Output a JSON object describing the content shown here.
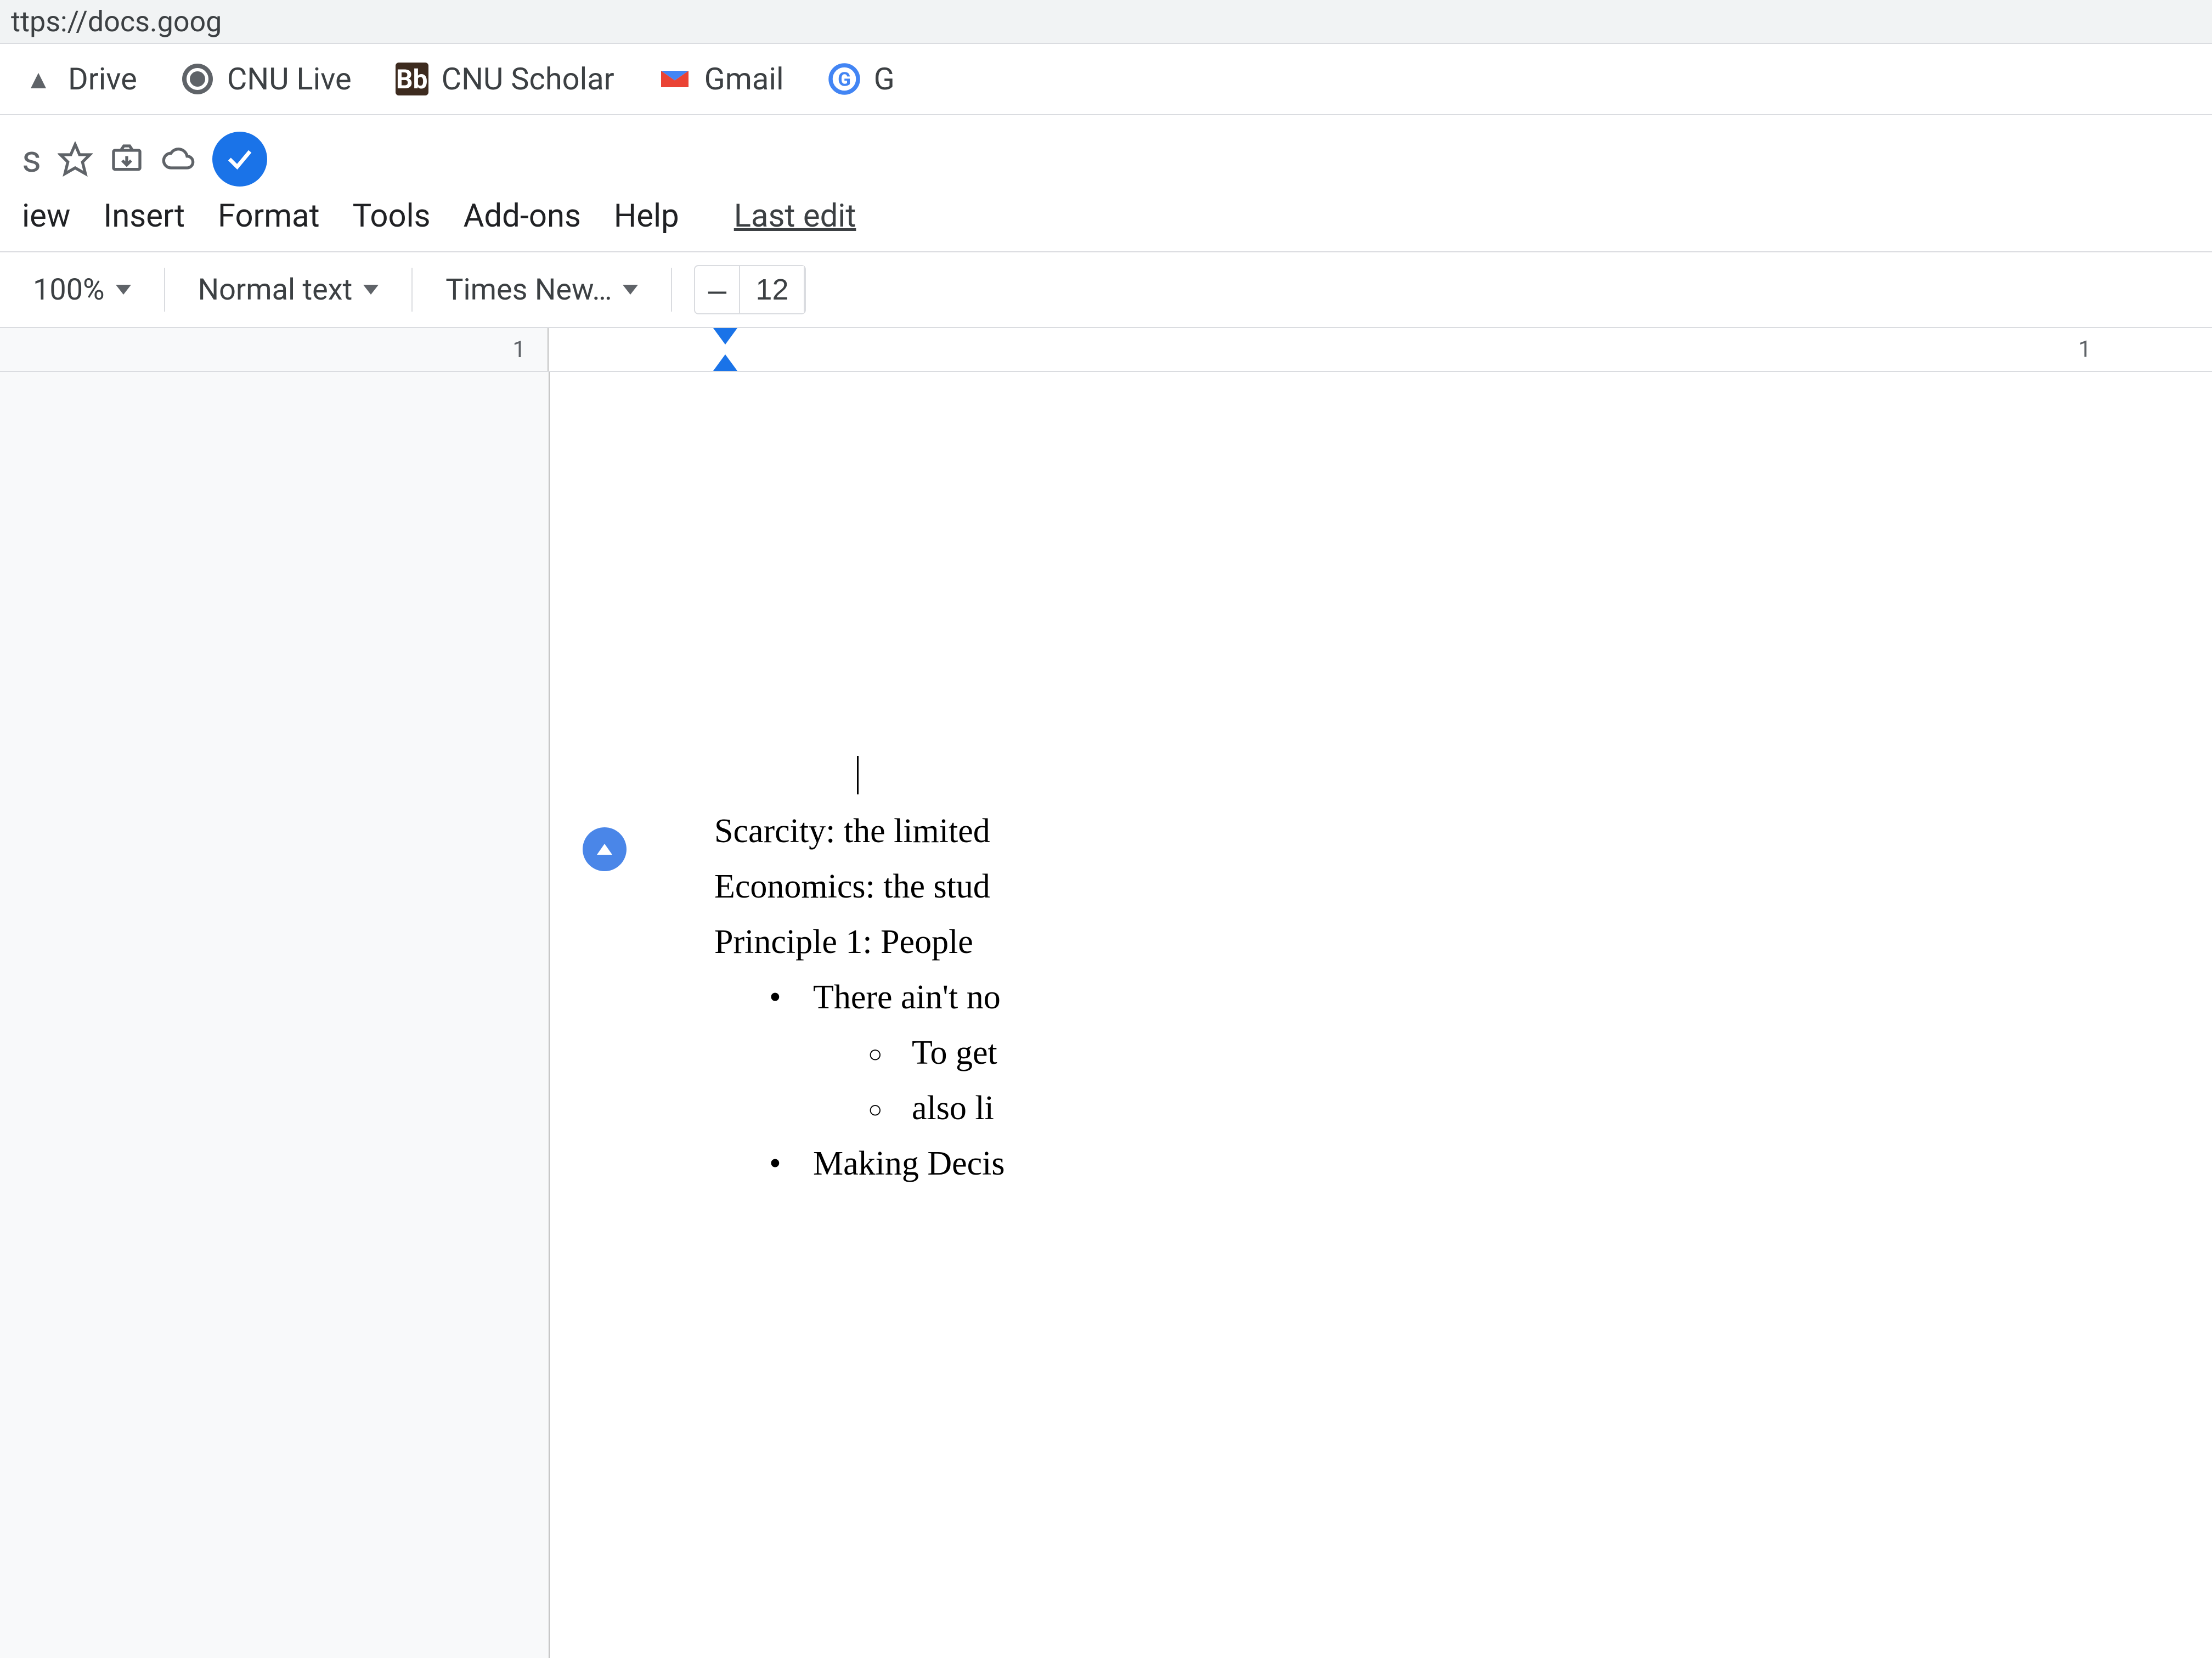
{
  "browser": {
    "url_fragment": "ttps://docs.goog",
    "bookmarks": [
      {
        "label": "Drive",
        "icon": "drive"
      },
      {
        "label": "CNU Live",
        "icon": "globe"
      },
      {
        "label": "CNU Scholar",
        "icon": "bb"
      },
      {
        "label": "Gmail",
        "icon": "gmail"
      },
      {
        "label": "G",
        "icon": "g"
      }
    ]
  },
  "docs": {
    "title_fragment": "s",
    "menus": [
      "iew",
      "Insert",
      "Format",
      "Tools",
      "Add-ons",
      "Help"
    ],
    "last_edit": "Last edit"
  },
  "toolbar": {
    "zoom": "100%",
    "style": "Normal text",
    "font": "Times New…",
    "font_size": "12",
    "minus": "–"
  },
  "ruler": {
    "left_num": "1",
    "nums": [
      "1"
    ]
  },
  "document": {
    "cursor_line": "",
    "lines": [
      "Scarcity: the limited",
      "Economics: the stud",
      "",
      "Principle 1: People "
    ],
    "bullets_l1": [
      "There ain't no"
    ],
    "bullets_l2": [
      "To get",
      "also li"
    ],
    "bullets_l1_b": [
      "Making Decis"
    ]
  }
}
